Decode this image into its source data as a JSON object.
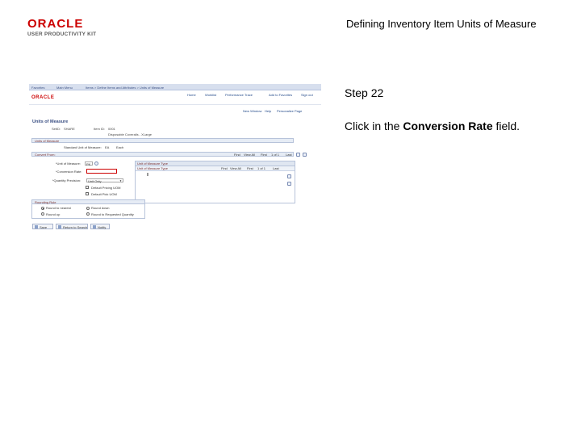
{
  "header": {
    "logo_text": "ORACLE",
    "logo_subtext": "USER PRODUCTIVITY KIT",
    "title": "Defining Inventory Item Units of Measure"
  },
  "step": {
    "label": "Step 22",
    "instruction_prefix": "Click in the ",
    "instruction_target": "Conversion Rate",
    "instruction_suffix": " field."
  },
  "screenshot": {
    "top_nav": [
      "Favorites",
      "Main Menu",
      "Items > Define Items and Attributes > Units of Measure"
    ],
    "brand": "ORACLE",
    "header_links": [
      "Home",
      "Worklist",
      "Performance Trace",
      "Add to Favorites",
      "Sign out"
    ],
    "sub_links": [
      "New Window",
      "Help",
      "Personalize Page"
    ],
    "page_title": "Units of Measure",
    "setid_label": "SetID:",
    "setid_value": "SHARE",
    "item_id_label": "Item ID:",
    "item_id_value": "0001",
    "item_desc": "Disposable Coveralls - XLarge",
    "section_unit": "Units of Measure",
    "std_uom_label": "Standard Unit of Measure:",
    "std_uom_value": "EA",
    "std_uom_desc": "Each",
    "section_convert": "Convert From:",
    "grid_nav": [
      "Find",
      "View All",
      "First",
      "1 of 1",
      "Last"
    ],
    "uom_label": "*Unit of Measure:",
    "uom_value": "PK",
    "conversion_rate_label": "*Conversion Rate:",
    "quantity_precision_label": "*Quantity Precision:",
    "quantity_precision_value": "Unit Only",
    "uom_type_section": "Unit of Measure Type",
    "uom_type_col": "Unit of Measure Type",
    "grid_nav2": [
      "Find",
      "View All",
      "First",
      "1 of 1",
      "Last"
    ],
    "default_pricing_uom": "Default Pricing UOM",
    "default_pick_uom": "Default Pick UOM",
    "rounding_rule_section": "Rounding Rule",
    "round_options": [
      "Round to nearest",
      "Round up",
      "Round down",
      "Round to Requested Quantity"
    ],
    "buttons": [
      "Save",
      "Return to Search",
      "Notify"
    ]
  }
}
